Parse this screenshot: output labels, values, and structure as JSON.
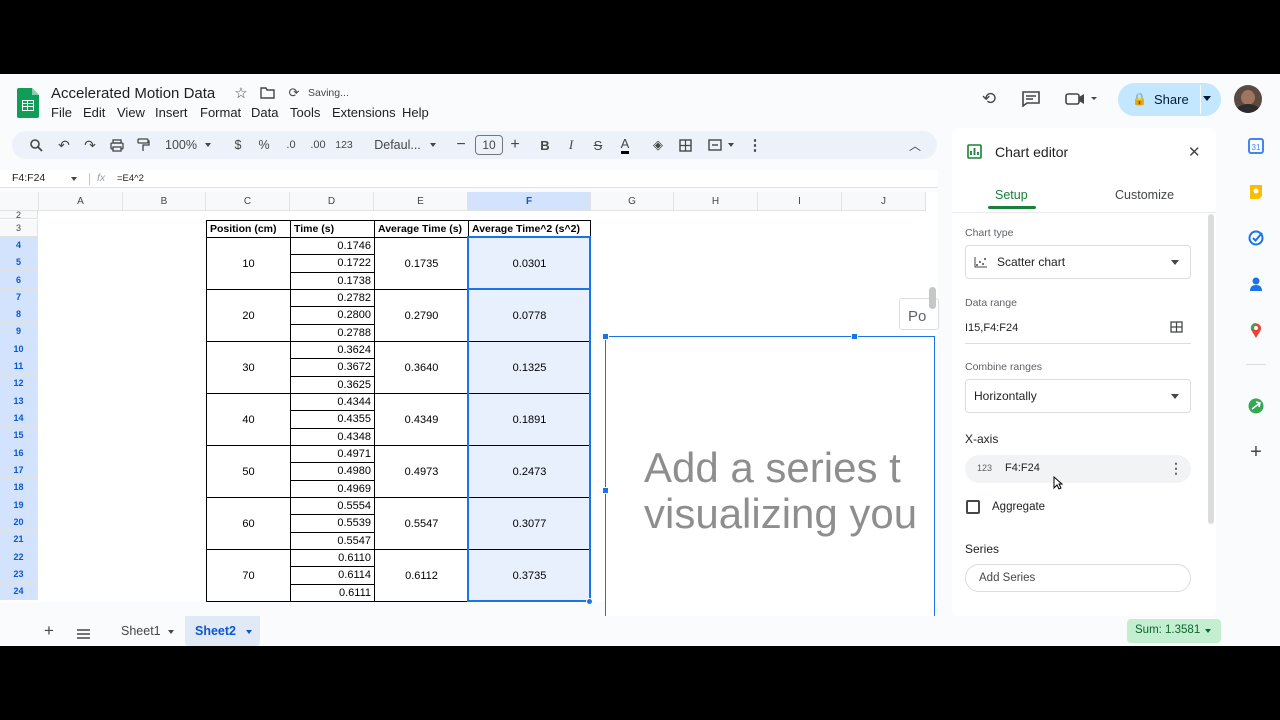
{
  "app": {
    "title": "Accelerated Motion Data",
    "status": "Saving..."
  },
  "menu": [
    "File",
    "Edit",
    "View",
    "Insert",
    "Format",
    "Data",
    "Tools",
    "Extensions",
    "Help"
  ],
  "share": {
    "label": "Share"
  },
  "toolbar": {
    "zoom": "100%",
    "currency": "$",
    "percent": "%",
    "dec_less": ".0",
    "dec_more": ".00",
    "format_num": "123",
    "font": "Defaul...",
    "font_size": "10",
    "bold": "B",
    "italic": "I",
    "strike": "S",
    "text_color": "A"
  },
  "formula": {
    "name_box": "F4:F24",
    "fx": "fx",
    "content": "=E4^2"
  },
  "columns": [
    "A",
    "B",
    "C",
    "D",
    "E",
    "F",
    "G",
    "H",
    "I",
    "J"
  ],
  "rows": [
    "2",
    "3",
    "4",
    "5",
    "6",
    "7",
    "8",
    "9",
    "10",
    "11",
    "12",
    "13",
    "14",
    "15",
    "16",
    "17",
    "18",
    "19",
    "20",
    "21",
    "22",
    "23",
    "24"
  ],
  "table": {
    "headers": [
      "Position (cm)",
      "Time (s)",
      "Average Time (s)",
      "Average Time^2 (s^2)"
    ],
    "groups": [
      {
        "position": "10",
        "times": [
          "0.1746",
          "0.1722",
          "0.1738"
        ],
        "avg": "0.1735",
        "avg_sq": "0.0301"
      },
      {
        "position": "20",
        "times": [
          "0.2782",
          "0.2800",
          "0.2788"
        ],
        "avg": "0.2790",
        "avg_sq": "0.0778"
      },
      {
        "position": "30",
        "times": [
          "0.3624",
          "0.3672",
          "0.3625"
        ],
        "avg": "0.3640",
        "avg_sq": "0.1325"
      },
      {
        "position": "40",
        "times": [
          "0.4344",
          "0.4355",
          "0.4348"
        ],
        "avg": "0.4349",
        "avg_sq": "0.1891"
      },
      {
        "position": "50",
        "times": [
          "0.4971",
          "0.4980",
          "0.4969"
        ],
        "avg": "0.4973",
        "avg_sq": "0.2473"
      },
      {
        "position": "60",
        "times": [
          "0.5554",
          "0.5539",
          "0.5547"
        ],
        "avg": "0.5547",
        "avg_sq": "0.3077"
      },
      {
        "position": "70",
        "times": [
          "0.6110",
          "0.6114",
          "0.6111"
        ],
        "avg": "0.6112",
        "avg_sq": "0.3735"
      }
    ]
  },
  "chart": {
    "message": "Add a series t\nvisualizing you",
    "tooltip": "Po"
  },
  "editor": {
    "title": "Chart editor",
    "tabs": [
      "Setup",
      "Customize"
    ],
    "chart_type_label": "Chart type",
    "chart_type": "Scatter chart",
    "data_range_label": "Data range",
    "data_range": "I15,F4:F24",
    "combine_label": "Combine ranges",
    "combine": "Horizontally",
    "xaxis_label": "X-axis",
    "xaxis_value": "F4:F24",
    "xaxis_icon": "123",
    "aggregate_label": "Aggregate",
    "series_label": "Series",
    "add_series": "Add Series"
  },
  "sheets": [
    "Sheet1",
    "Sheet2"
  ],
  "sum": "Sum: 1.3581",
  "colors": {
    "accent": "#0b57d0",
    "select_bg": "#e8f0fe",
    "share_bg": "#c2e7ff",
    "sum_bg": "#c4eed0"
  }
}
